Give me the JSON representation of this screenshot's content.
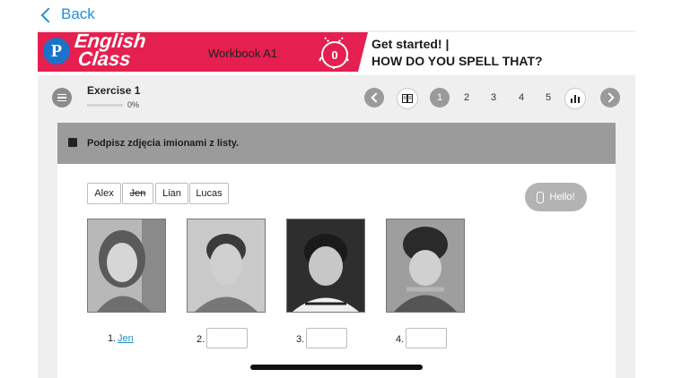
{
  "nav": {
    "back_label": "Back"
  },
  "header": {
    "brand_line1": "English",
    "brand_line2": "Class",
    "workbook": "Workbook A1",
    "score": "0",
    "title_line1": "Get started! |",
    "title_line2": "HOW DO YOU SPELL THAT?"
  },
  "exercise": {
    "title": "Exercise 1",
    "progress_percent": "0%",
    "progress_value": 0,
    "pages": [
      "1",
      "2",
      "3",
      "4",
      "5"
    ],
    "active_page": "1"
  },
  "instruction": "Podpisz zdjęcia imionami z listy.",
  "word_bank": [
    {
      "label": "Alex",
      "used": false
    },
    {
      "label": "Jen",
      "used": true
    },
    {
      "label": "Lian",
      "used": false
    },
    {
      "label": "Lucas",
      "used": false
    }
  ],
  "hello_button": "Hello!",
  "photos": [
    {
      "number": "1.",
      "answer": "Jen"
    },
    {
      "number": "2.",
      "answer": ""
    },
    {
      "number": "3.",
      "answer": ""
    },
    {
      "number": "4.",
      "answer": ""
    }
  ],
  "colors": {
    "brand_red": "#e51f4f",
    "pearson_blue": "#1a73c9",
    "link_blue": "#1a8ec9",
    "back_blue": "#1f8fe0"
  },
  "icons": [
    "chevron-left-icon",
    "menu-icon",
    "book-icon",
    "stats-icon",
    "chevron-right-icon",
    "task-icon",
    "paperclip-icon",
    "medal-icon"
  ]
}
